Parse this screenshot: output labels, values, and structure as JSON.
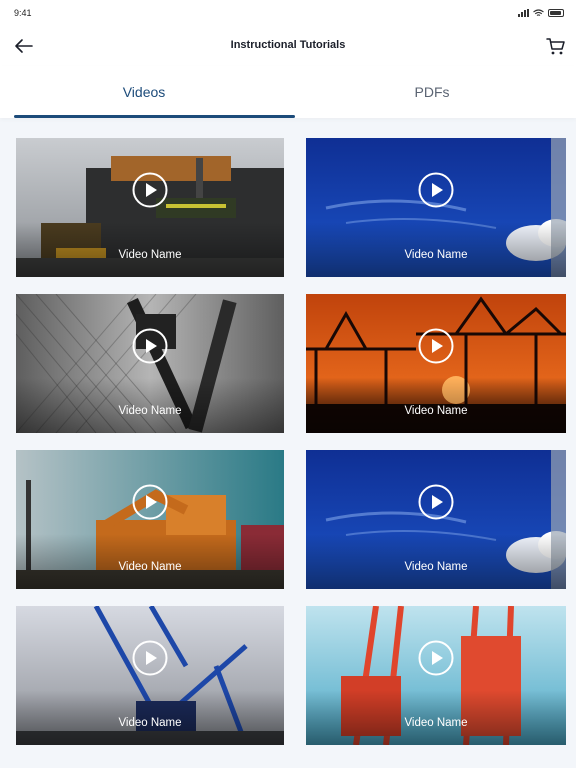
{
  "status_bar": {
    "time": "9:41"
  },
  "header": {
    "title": "Instructional Tutorials"
  },
  "tabs": [
    {
      "label": "Videos",
      "active": true
    },
    {
      "label": "PDFs",
      "active": false
    }
  ],
  "videos": [
    {
      "name": "Video Name",
      "scene": "tractor"
    },
    {
      "name": "Video Name",
      "scene": "sky"
    },
    {
      "name": "Video Name",
      "scene": "crane-mono"
    },
    {
      "name": "Video Name",
      "scene": "sunset-port"
    },
    {
      "name": "Video Name",
      "scene": "excavator"
    },
    {
      "name": "Video Name",
      "scene": "sky"
    },
    {
      "name": "Video Name",
      "scene": "blue-crane"
    },
    {
      "name": "Video Name",
      "scene": "red-crane"
    }
  ],
  "colors": {
    "accent": "#1c4b7a",
    "background": "#f3f6fa"
  }
}
